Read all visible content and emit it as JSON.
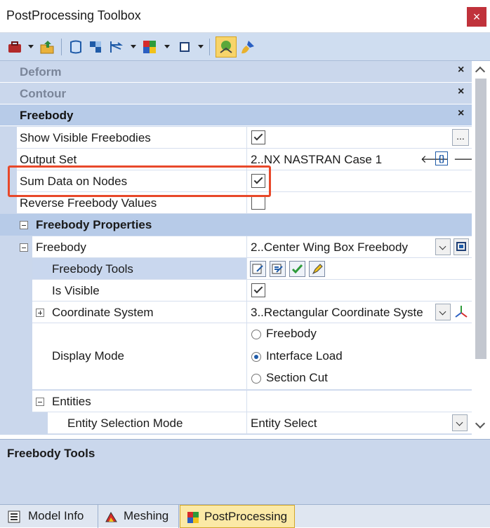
{
  "window": {
    "title": "PostProcessing Toolbox",
    "close_glyph": "×"
  },
  "toolbar": {
    "icons": [
      "toolbox-icon",
      "open-folder-icon",
      "deform-icon",
      "contour-icon",
      "freebody-icon",
      "colors-icon",
      "view-icon",
      "freebody-tool-icon",
      "brush-icon"
    ],
    "accent": "#f7d46a"
  },
  "categories": {
    "deform": "Deform",
    "contour": "Contour",
    "freebody": "Freebody",
    "close_glyph": "×"
  },
  "properties": {
    "show_visible": {
      "label": "Show Visible Freebodies",
      "checked": true,
      "ellipsis": "..."
    },
    "output_set": {
      "label": "Output Set",
      "value": "2..NX NASTRAN Case 1",
      "nav_prev": "🡐",
      "nav_mid": "{}",
      "nav_next": "🡒"
    },
    "sum_data": {
      "label": "Sum Data on Nodes",
      "checked": true
    },
    "reverse": {
      "label": "Reverse Freebody Values",
      "checked": false
    }
  },
  "freebody_properties": {
    "header": "Freebody Properties",
    "freebody": {
      "label": "Freebody",
      "value": "2..Center Wing Box Freebody"
    },
    "tools": {
      "label": "Freebody Tools"
    },
    "is_visible": {
      "label": "Is Visible",
      "checked": true
    },
    "coord_system": {
      "label": "Coordinate System",
      "value": "3..Rectangular Coordinate Syste"
    },
    "display_mode": {
      "label": "Display Mode",
      "options": [
        "Freebody",
        "Interface Load",
        "Section Cut"
      ],
      "selected": "Interface Load"
    },
    "entities": {
      "label": "Entities",
      "selection_mode": {
        "label": "Entity Selection Mode",
        "value": "Entity Select"
      }
    }
  },
  "description": {
    "title": "Freebody Tools"
  },
  "tabs": [
    {
      "label": "Model Info",
      "active": false
    },
    {
      "label": "Meshing",
      "active": false
    },
    {
      "label": "PostProcessing",
      "active": true
    }
  ]
}
